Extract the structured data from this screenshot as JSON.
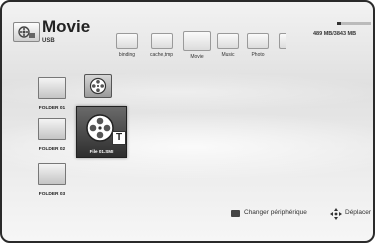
{
  "header": {
    "title": "Movie",
    "subtitle": "USB",
    "storage": "489 MB/3843 MB",
    "storage_used_fraction": 0.13,
    "source_icon": "usb-source-icon"
  },
  "folder_strip": [
    {
      "label": "binding",
      "icon": "folder-icon"
    },
    {
      "label": "cache,tmp",
      "icon": "folder-icon"
    },
    {
      "label": "Movie",
      "icon": "folder-icon",
      "active": true
    },
    {
      "label": "Music",
      "icon": "folder-icon"
    },
    {
      "label": "Photo",
      "icon": "folder-icon"
    },
    {
      "label": "",
      "icon": "folder-icon",
      "partial": true
    }
  ],
  "grid": {
    "folders": [
      {
        "label": "FOLDER 01",
        "icon": "folder-icon"
      },
      {
        "label": "FOLDER 02",
        "icon": "folder-icon"
      },
      {
        "label": "FOLDER 03",
        "icon": "folder-icon"
      }
    ],
    "selected_file": {
      "label": "File 01.SMI",
      "badge": "T",
      "icon": "film-reel-icon"
    },
    "extra_icon": "film-reel-icon"
  },
  "footer": {
    "change_device": "Changer périphérique",
    "move": "Déplacer",
    "key_color": "#444444"
  }
}
